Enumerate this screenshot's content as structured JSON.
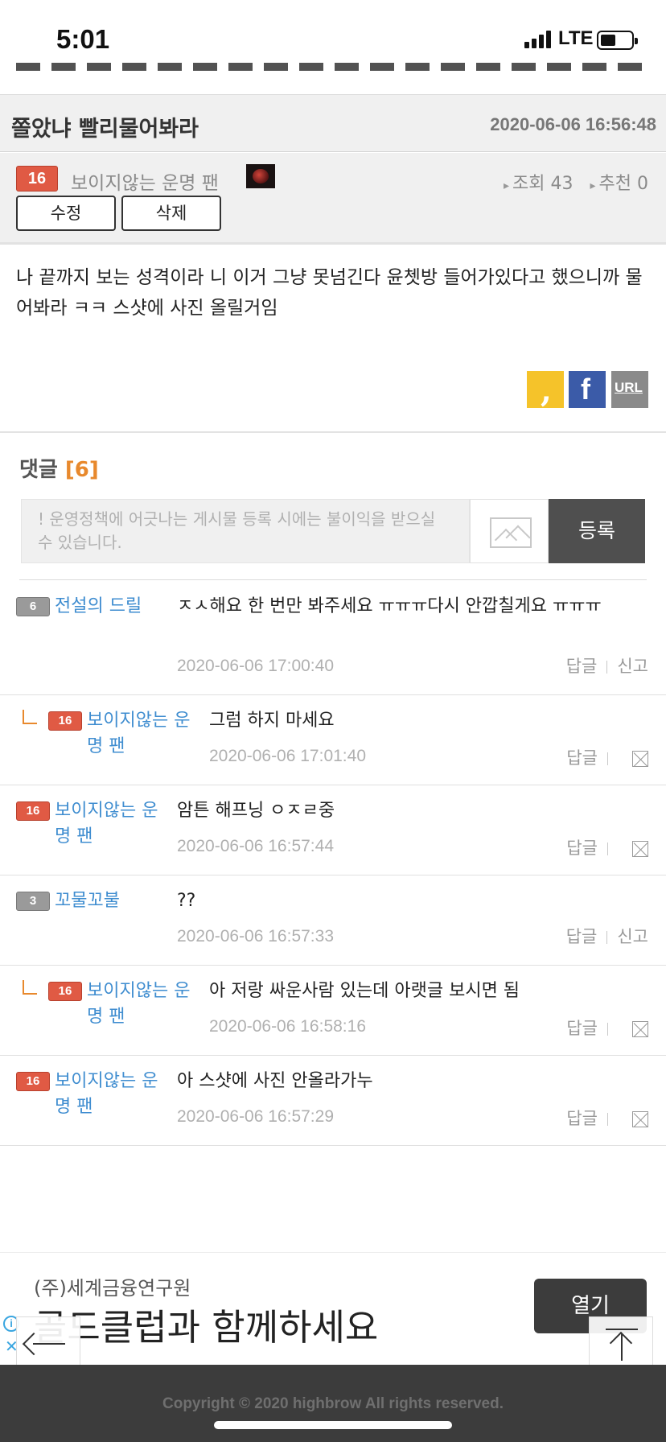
{
  "status_bar": {
    "time": "5:01",
    "network": "LTE"
  },
  "post": {
    "title": "쫄았냐 빨리물어봐라",
    "date": "2020-06-06 16:56:48",
    "author_level": "16",
    "author": "보이지않는 운명 팬",
    "views_label": "조회 43",
    "recommend_label": "추천 0",
    "edit_label": "수정",
    "delete_label": "삭제",
    "body": "나 끝까지 보는 성격이라 니 이거 그냥 못넘긴다 윤쳇방 들어가있다고 했으니까 물어봐라 ㅋㅋ 스샷에 사진 올릴거임"
  },
  "share": {
    "kakao_icon": "kakao-icon",
    "facebook_icon": "facebook-icon",
    "url_label": "URL"
  },
  "comments_section": {
    "label": "댓글",
    "count": "[6]",
    "placeholder": "! 운영정책에 어긋나는 게시물 등록 시에는 불이익을 받으실 수 있습니다.",
    "submit_label": "등록"
  },
  "comments": [
    {
      "level": "6",
      "author": "전설의 드릴",
      "text": "ㅈㅅ해요 한 번만 봐주세요 ㅠㅠㅠ다시 안깝칠게요 ㅠㅠㅠ",
      "date": "2020-06-06 17:00:40",
      "reply": "답글",
      "report": "신고"
    },
    {
      "level": "16",
      "author": "보이지않는 운명 팬",
      "text": "그럼 하지 마세요",
      "date": "2020-06-06 17:01:40",
      "reply": "답글"
    },
    {
      "level": "16",
      "author": "보이지않는 운명 팬",
      "text": "암튼 해프닝 ㅇㅈㄹ중",
      "date": "2020-06-06 16:57:44",
      "reply": "답글"
    },
    {
      "level": "3",
      "author": "꼬물꼬불",
      "text": "??",
      "date": "2020-06-06 16:57:33",
      "reply": "답글",
      "report": "신고"
    },
    {
      "level": "16",
      "author": "보이지않는 운명 팬",
      "text": "아 저랑 싸운사람 있는데 아랫글 보시면 됨",
      "date": "2020-06-06 16:58:16",
      "reply": "답글"
    },
    {
      "level": "16",
      "author": "보이지않는 운명 팬",
      "text": "아 스샷에 사진 안올라가누",
      "date": "2020-06-06 16:57:29",
      "reply": "답글"
    }
  ],
  "ad": {
    "company": "(주)세계금융연구원",
    "headline": "골드클럽과 함께하세요",
    "open_label": "열기"
  },
  "footer": {
    "copyright": "Copyright © 2020 highbrow All rights reserved."
  },
  "colors": {
    "accent_orange": "#e8892d",
    "author_blue": "#3f8dd0",
    "badge_red": "#e05a44",
    "badge_gray": "#9a9a9a"
  }
}
